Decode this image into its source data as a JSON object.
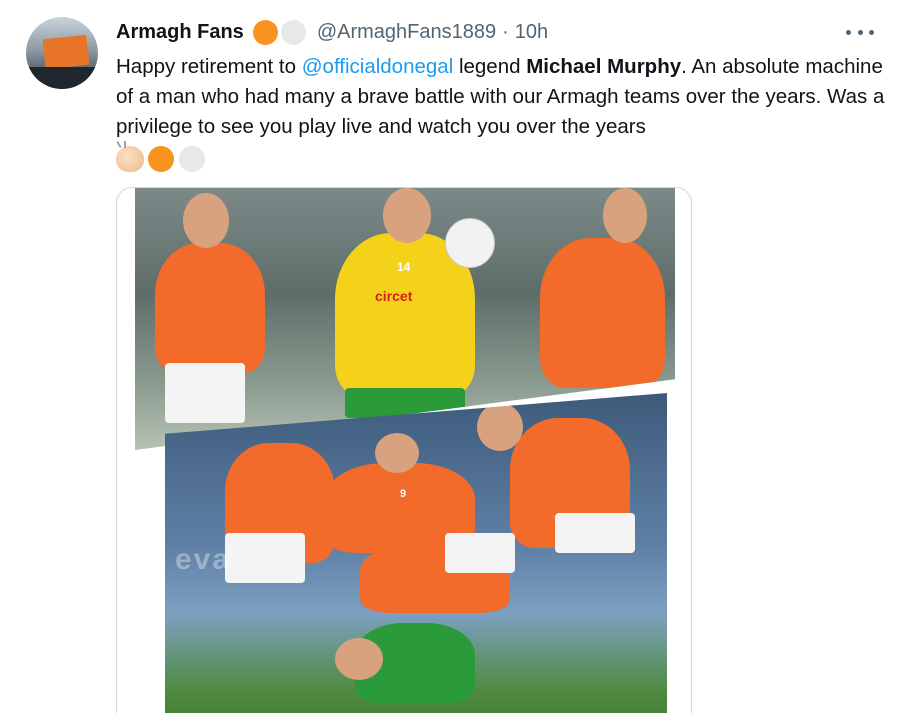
{
  "tweet": {
    "display_name": "Armagh Fans",
    "handle": "@ArmaghFans1889",
    "separator": "·",
    "time": "10h",
    "text": {
      "part1": "Happy retirement to ",
      "mention": "@officialdonegal",
      "part2": " legend ",
      "bold": "Michael Murphy",
      "part3": ". An absolute machine of a man who had many a brave battle with our Armagh teams over the years. Was a privilege to see you play live and watch you over the years"
    },
    "emojis": [
      "clapping-hands",
      "orange-circle",
      "white-circle"
    ],
    "badge_colors": {
      "orange": "#f7931e",
      "white": "#e6e8ea"
    }
  },
  "media": {
    "photo_top": {
      "sponsor": "circet",
      "jersey_number": "14"
    },
    "photo_bottom": {
      "jersey_number": "9",
      "watermark": "eva"
    }
  },
  "colors": {
    "mention": "#1d9bf0",
    "text": "#0f1419",
    "muted": "#536471"
  }
}
